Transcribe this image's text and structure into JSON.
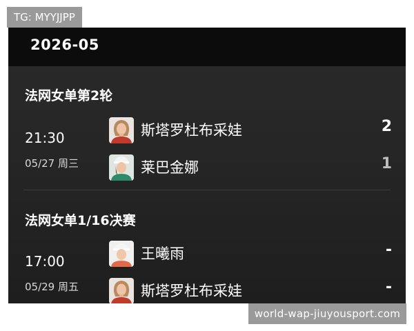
{
  "header": {
    "month": "2026-05"
  },
  "matches": [
    {
      "title": "法网女单第2轮",
      "time": "21:30",
      "date": "05/27  周三",
      "players": [
        {
          "name": "斯塔罗杜布采娃",
          "score": "2",
          "avatar": "player-avatar"
        },
        {
          "name": "莱巴金娜",
          "score": "1",
          "avatar": "player-avatar"
        }
      ]
    },
    {
      "title": "法网女单1/16决赛",
      "time": "17:00",
      "date": "05/29  周五",
      "players": [
        {
          "name": "王曦雨",
          "score": "-",
          "avatar": "player-avatar"
        },
        {
          "name": "斯塔罗杜布采娃",
          "score": "-",
          "avatar": "player-avatar"
        }
      ]
    }
  ],
  "watermarks": {
    "top": "TG: MYYJJPP",
    "bottom": "world-wap-jiuyousport.com"
  },
  "colors": {
    "panel_bg": "#262626",
    "header_bg": "#0c0c0c",
    "text": "#ffffff",
    "watermark_bg": "#9a9a9a"
  }
}
